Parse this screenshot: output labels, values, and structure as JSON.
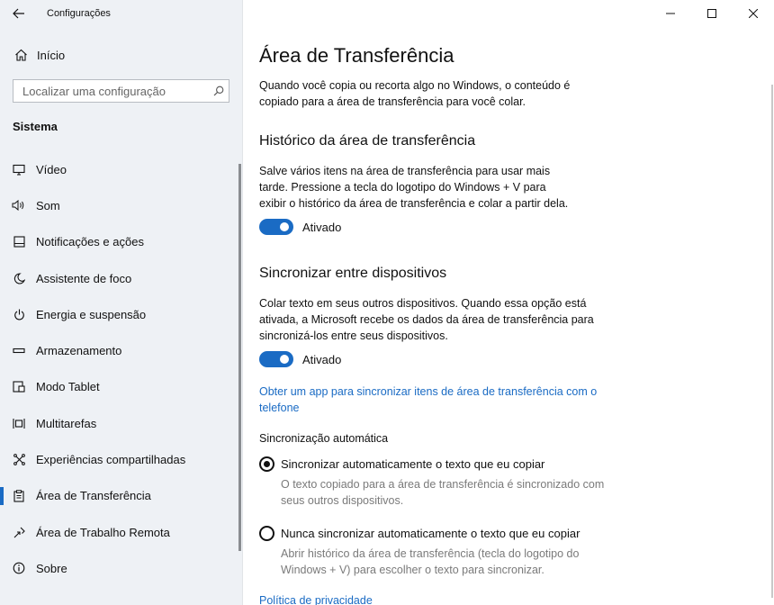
{
  "window": {
    "title": "Configurações",
    "controls": {
      "minimize": "—",
      "maximize": "☐",
      "close": "✕"
    }
  },
  "sidebar": {
    "home_label": "Início",
    "search_placeholder": "Localizar uma configuração",
    "section": "Sistema",
    "items": [
      {
        "label": "Vídeo",
        "icon": "monitor-icon"
      },
      {
        "label": "Som",
        "icon": "speaker-icon"
      },
      {
        "label": "Notificações e ações",
        "icon": "notification-icon"
      },
      {
        "label": "Assistente de foco",
        "icon": "moon-icon"
      },
      {
        "label": "Energia e suspensão",
        "icon": "power-icon"
      },
      {
        "label": "Armazenamento",
        "icon": "storage-icon"
      },
      {
        "label": "Modo Tablet",
        "icon": "tablet-icon"
      },
      {
        "label": "Multitarefas",
        "icon": "multitask-icon"
      },
      {
        "label": "Experiências compartilhadas",
        "icon": "share-icon"
      },
      {
        "label": "Área de Transferência",
        "icon": "clipboard-icon",
        "selected": true
      },
      {
        "label": "Área de Trabalho Remota",
        "icon": "remote-icon"
      },
      {
        "label": "Sobre",
        "icon": "info-icon"
      }
    ]
  },
  "main": {
    "title": "Área de Transferência",
    "intro": "Quando você copia ou recorta algo no Windows, o conteúdo é copiado para a área de transferência para você colar.",
    "history": {
      "heading": "Histórico da área de transferência",
      "description": "Salve vários itens na área de transferência para usar mais tarde. Pressione a tecla do logotipo do Windows + V para exibir o histórico da área de transferência e colar a partir dela.",
      "toggle_state": "Ativado"
    },
    "sync": {
      "heading": "Sincronizar entre dispositivos",
      "description": "Colar texto em seus outros dispositivos. Quando essa opção está ativada, a Microsoft recebe os dados da área de transferência para sincronizá-los entre seus dispositivos.",
      "toggle_state": "Ativado",
      "app_link": "Obter um app para sincronizar itens de área de transferência com o telefone",
      "auto_label": "Sincronização automática",
      "option1_label": "Sincronizar automaticamente o texto que eu copiar",
      "option1_desc": "O texto copiado para a área de transferência é sincronizado com seus outros dispositivos.",
      "option2_label": "Nunca sincronizar automaticamente o texto que eu copiar",
      "option2_desc": "Abrir histórico da área de transferência (tecla do logotipo do Windows + V) para escolher o texto para sincronizar."
    },
    "privacy_link": "Política de privacidade"
  },
  "colors": {
    "accent": "#1a6bc4",
    "sidebar_bg": "#eef1f5"
  }
}
